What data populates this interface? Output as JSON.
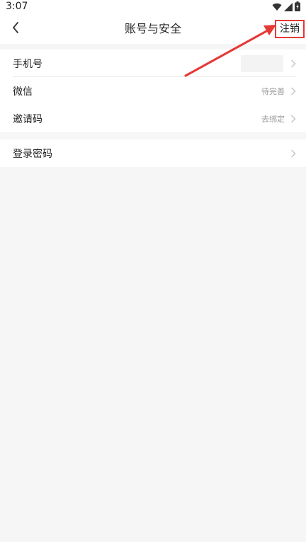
{
  "status_bar": {
    "time": "3:07"
  },
  "header": {
    "title": "账号与安全",
    "action_label": "注销"
  },
  "settings": {
    "group1": [
      {
        "label": "手机号",
        "value": ""
      },
      {
        "label": "微信",
        "value": "待完善"
      },
      {
        "label": "邀请码",
        "value": "去绑定"
      }
    ],
    "group2": [
      {
        "label": "登录密码",
        "value": ""
      }
    ]
  },
  "colors": {
    "highlight": "#e53935",
    "background": "#f6f6f6"
  },
  "icons": [
    "wifi-icon",
    "signal-icon",
    "battery-icon",
    "back-arrow-icon",
    "chevron-right-icon"
  ]
}
